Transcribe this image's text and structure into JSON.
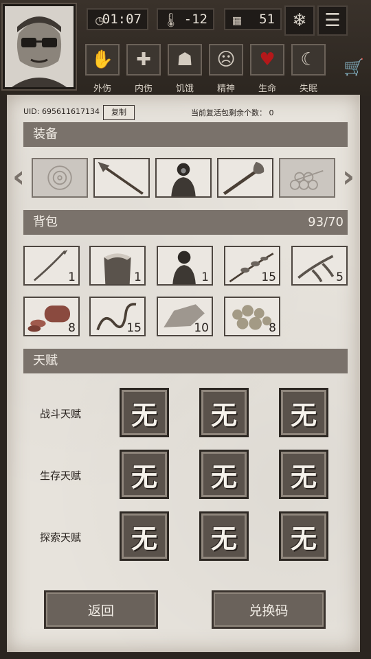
{
  "header": {
    "time": "01:07",
    "temperature": "-12",
    "day": "51",
    "status_items": [
      {
        "label": "外伤",
        "icon": "hand-icon"
      },
      {
        "label": "内伤",
        "icon": "cross-icon"
      },
      {
        "label": "饥饿",
        "icon": "stomach-icon"
      },
      {
        "label": "精神",
        "icon": "head-icon"
      },
      {
        "label": "生命",
        "icon": "heart-icon"
      },
      {
        "label": "失眠",
        "icon": "moon-icon"
      }
    ]
  },
  "account": {
    "uid": "UID: 695611617134",
    "copy_label": "复制",
    "revive_text": "当前复活包剩余个数： 0"
  },
  "equipment": {
    "title": "装备",
    "slots": [
      {
        "name": "empty-target-slot",
        "count": ""
      },
      {
        "name": "spear",
        "count": ""
      },
      {
        "name": "hazmat-suit",
        "count": ""
      },
      {
        "name": "torch",
        "count": ""
      },
      {
        "name": "logs-empty",
        "count": ""
      }
    ]
  },
  "backpack": {
    "title": "背包",
    "capacity": "93/70",
    "items": [
      {
        "name": "sabre",
        "count": "1"
      },
      {
        "name": "fur-coat",
        "count": "1"
      },
      {
        "name": "hazmat-suit",
        "count": "1"
      },
      {
        "name": "herb-branch",
        "count": "15"
      },
      {
        "name": "root",
        "count": "5"
      },
      {
        "name": "sausage",
        "count": "8"
      },
      {
        "name": "rope",
        "count": "15"
      },
      {
        "name": "stone",
        "count": "10"
      },
      {
        "name": "ore",
        "count": "8"
      }
    ]
  },
  "talents": {
    "title": "天赋",
    "rows": [
      {
        "label": "战斗天赋",
        "slots": [
          "无",
          "无",
          "无"
        ]
      },
      {
        "label": "生存天赋",
        "slots": [
          "无",
          "无",
          "无"
        ]
      },
      {
        "label": "探索天赋",
        "slots": [
          "无",
          "无",
          "无"
        ]
      }
    ]
  },
  "buttons": {
    "back": "返回",
    "redeem": "兑换码"
  }
}
